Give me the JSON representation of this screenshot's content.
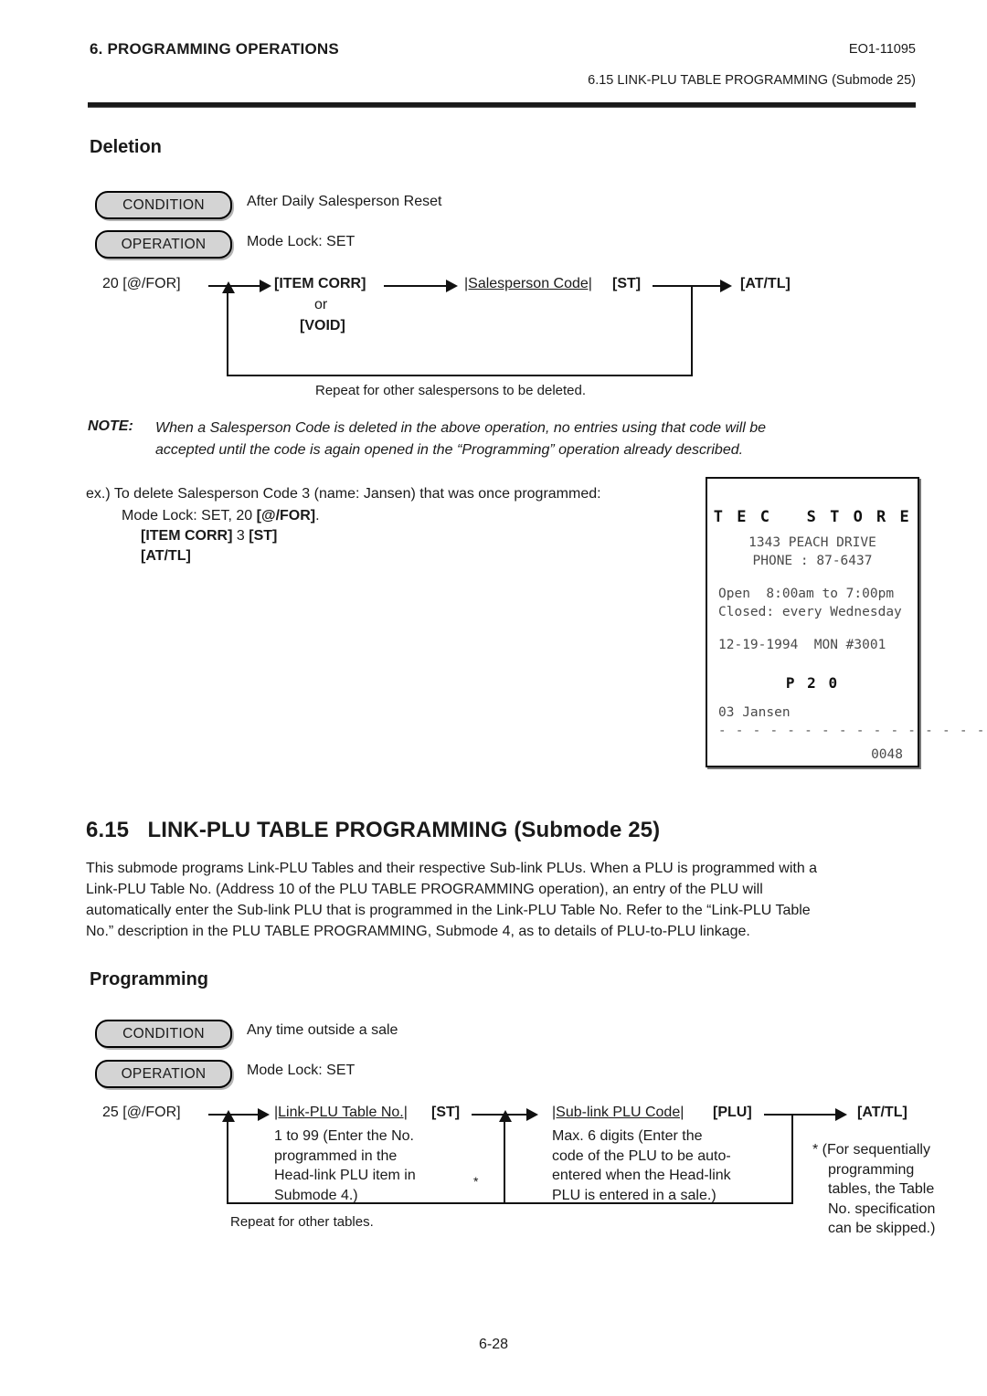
{
  "header": {
    "chapter": "6.  PROGRAMMING OPERATIONS",
    "doc_code": "EO1-11095",
    "section_ref": "6.15  LINK-PLU TABLE PROGRAMMING (Submode 25)"
  },
  "deletion": {
    "heading": "Deletion",
    "condition_label": "CONDITION",
    "condition_value": "After Daily Salesperson Reset",
    "operation_label": "OPERATION",
    "operation_value": "Mode Lock:  SET",
    "flow": {
      "start": "20 [@/FOR]",
      "step1": "[ITEM CORR]",
      "or": "or",
      "step1_alt": "[VOID]",
      "step2_field": "|Salesperson Code|",
      "step2_key": "[ST]",
      "step3": "[AT/TL]",
      "loop_caption": "Repeat for other salespersons to be deleted."
    },
    "note_label": "NOTE:",
    "note_line1": "When a Salesperson Code is deleted in the above operation, no entries using that code will be",
    "note_line2": "accepted until the code is again opened in the “Programming” operation already described.",
    "example": {
      "line1": "ex.)  To delete Salesperson Code 3 (name:  Jansen) that was once programmed:",
      "line2_a": "Mode Lock:  SET, 20 ",
      "line2_b": "[@/FOR]",
      "line2_c": ".",
      "line3_a": "[ITEM CORR]",
      "line3_b": "  3 ",
      "line3_c": "[ST]",
      "line4": "[AT/TL]"
    }
  },
  "receipt": {
    "store_name": "T E C   S T O R E",
    "address": "1343 PEACH DRIVE",
    "phone": "PHONE : 87-6437",
    "open_hours": "Open  8:00am to 7:00pm",
    "closed": "Closed: every Wednesday",
    "date_line": "12-19-1994  MON #3001",
    "mode": "P 2 0",
    "entry": "03 Jansen",
    "separator": "- - - - - - - - - - - - - - - - - - - - -",
    "counter": "0048"
  },
  "section": {
    "number": "6.15",
    "title": "LINK-PLU TABLE PROGRAMMING (Submode 25)",
    "body_line1": "This submode programs Link-PLU Tables and their respective Sub-link PLUs. When a PLU is programmed with a",
    "body_line2": "Link-PLU Table No. (Address 10 of the PLU TABLE PROGRAMMING operation), an entry of the PLU will",
    "body_line3": "automatically enter the Sub-link PLU that is programmed in the Link-PLU Table No.  Refer to the “Link-PLU Table",
    "body_line4": "No.” description in the PLU TABLE PROGRAMMING, Submode 4, as to details of PLU-to-PLU linkage."
  },
  "programming": {
    "heading": "Programming",
    "condition_label": "CONDITION",
    "condition_value": "Any time outside a sale",
    "operation_label": "OPERATION",
    "operation_value": "Mode Lock:  SET",
    "flow": {
      "start": "25  [@/FOR]",
      "step1_field": "|Link-PLU Table No.|",
      "step1_key": "[ST]",
      "step1_note_l1": "1 to 99 (Enter the No.",
      "step1_note_l2": "programmed in the",
      "step1_note_l3": "Head-link PLU item in",
      "step1_note_l4": "Submode 4.)",
      "asterisk": "*",
      "step2_field": "|Sub-link PLU Code|",
      "step2_key": "[PLU]",
      "step2_note_l1": "Max. 6 digits (Enter the",
      "step2_note_l2": "code of the PLU to be auto-",
      "step2_note_l3": "entered when the Head-link",
      "step2_note_l4": "PLU is entered in a sale.)",
      "step3": "[AT/TL]",
      "right_note_l1": "*  (For sequentially",
      "right_note_l2": "programming",
      "right_note_l3": "tables, the Table",
      "right_note_l4": "No. specification",
      "right_note_l5": "can be skipped.)",
      "loop_caption": "Repeat for other tables."
    }
  },
  "footer": {
    "page_number": "6-28"
  }
}
